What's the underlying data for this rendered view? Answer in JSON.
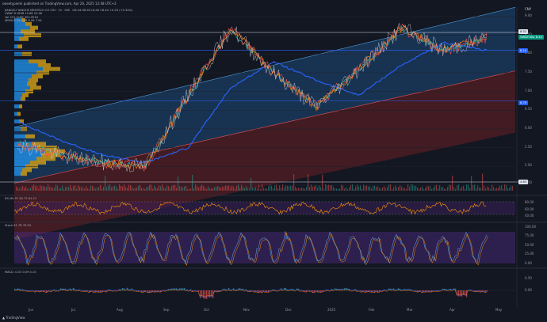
{
  "header": {
    "publish_line": "sweetypiemi published on TradingView.com, Apr 26, 2025 12:48 UTC+2"
  },
  "main_legend": {
    "symbol_line": "JIANGSU YANGHE MEDTECH CO LTD · 1h · SZE",
    "ohlc": "O8.44  H8.45  L8.40  C8.44  +0.03 (+0.34%)",
    "vwap": "VWAP  8.1838  10.66  10.48",
    "vol": "Vol  251.418K  354.951K",
    "ema": "4EMA  8.29  8.16  8.06  7.94"
  },
  "price_axis": {
    "unit": "CNY",
    "ticks": [
      "9.00",
      "8.50",
      "8.00",
      "7.50",
      "7.00",
      "6.50",
      "6.00",
      "5.50",
      "5.00",
      "4.50"
    ]
  },
  "price_badges": [
    {
      "label": "8.52",
      "color": "#e0e3eb",
      "text_color": "#131722"
    },
    {
      "label": "VWAP-VAL  8.44",
      "color": "#089981",
      "text_color": "#ffffff"
    },
    {
      "label": "8.10",
      "color": "#2962ff",
      "text_color": "#ffffff"
    },
    {
      "label": "6.75",
      "color": "#2962ff",
      "text_color": "#ffffff"
    },
    {
      "label": "4.63",
      "color": "#e0e3eb",
      "text_color": "#131722"
    }
  ],
  "rsi": {
    "legend": "RSI  60.57  62.72  61.21",
    "ticks": [
      "80.00",
      "60.00",
      "40.00"
    ],
    "color": "#ff9800"
  },
  "stoch": {
    "legend": "Stoch  61.78  70.53",
    "ticks": [
      "100.00",
      "75.00",
      "50.00",
      "25.00",
      "0.00"
    ],
    "color": "#2962ff"
  },
  "macd": {
    "legend": "MACD  -0.01  0.09  0.10",
    "ticks": [
      "0.50",
      "0.00"
    ]
  },
  "time_axis": [
    "Jun",
    "Jul",
    "Aug",
    "Sep",
    "Oct",
    "Nov",
    "Dec",
    "2025",
    "Feb",
    "Mar",
    "Apr",
    "May"
  ],
  "footer": {
    "brand": "TradingView"
  },
  "colors": {
    "background": "#131722",
    "upper_channel": "#1e4a7a",
    "lower_channel": "#6a1f24",
    "price_line": "#d1d4dc",
    "ema_blue": "#2962ff",
    "ema_green": "#26a69a",
    "ema_orange": "#f57c00",
    "ema_red": "#ef5350",
    "vp_blue": "#2196f3",
    "vp_gold": "#d4a017",
    "rsi_band": "#3b1f5c"
  },
  "chart_data": {
    "type": "line",
    "xlabel": "",
    "ylabel": "",
    "x": [
      "Jun",
      "Jul",
      "Aug",
      "Sep",
      "Oct",
      "Nov",
      "Dec",
      "2025",
      "Feb",
      "Mar",
      "Apr",
      "May"
    ],
    "ylim": [
      4.5,
      9.0
    ],
    "series": [
      {
        "values": [
          5.6,
          5.3,
          5.1,
          5.0,
          6.9,
          8.7,
          7.5,
          6.6,
          7.6,
          8.7,
          8.1,
          8.44
        ]
      },
      {
        "values": [
          6.2,
          5.7,
          5.3,
          5.1,
          5.5,
          7.1,
          7.8,
          7.3,
          6.9,
          7.7,
          8.3,
          8.1
        ]
      }
    ]
  }
}
